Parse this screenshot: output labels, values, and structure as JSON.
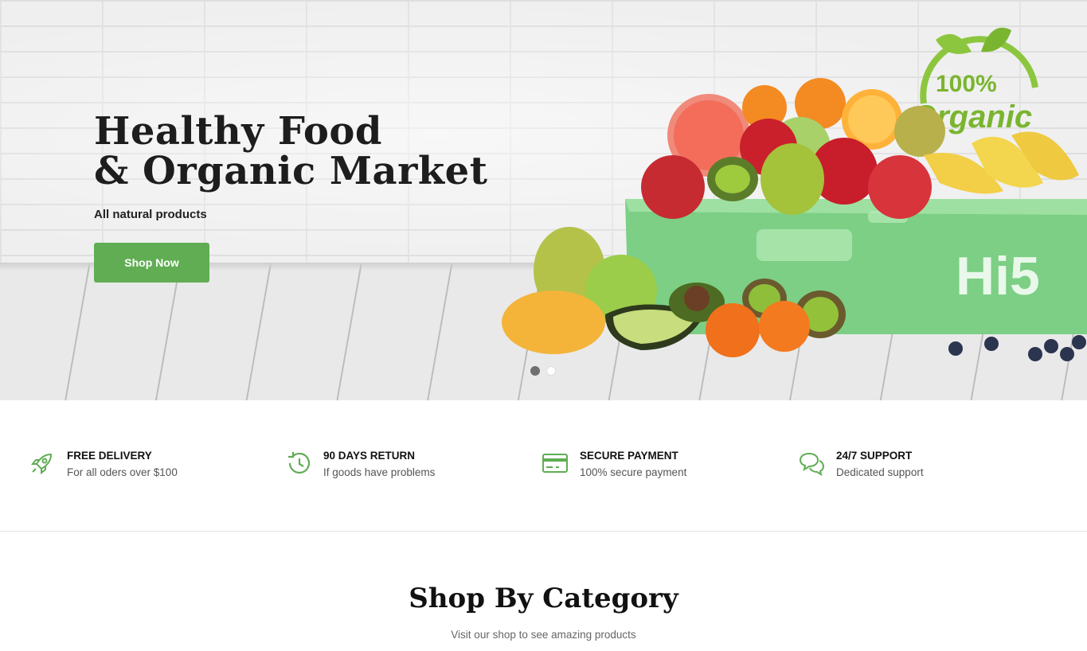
{
  "hero": {
    "title_line1": "Healthy Food",
    "title_line2": "& Organic Market",
    "subtitle": "All natural products",
    "button_label": "Shop Now",
    "badge_text": "100%",
    "badge_word": "Organic",
    "box_brand": "Hi5",
    "slides": 2,
    "active_slide": 1,
    "accent_color": "#60ad54"
  },
  "features": [
    {
      "icon": "rocket-icon",
      "title": "FREE DELIVERY",
      "desc": "For all oders over $100"
    },
    {
      "icon": "history-icon",
      "title": "90 DAYS RETURN",
      "desc": "If goods have problems"
    },
    {
      "icon": "credit-card-icon",
      "title": "SECURE PAYMENT",
      "desc": "100% secure payment"
    },
    {
      "icon": "chat-bubbles-icon",
      "title": "24/7 SUPPORT",
      "desc": "Dedicated support"
    }
  ],
  "category": {
    "title": "Shop By Category",
    "subtitle": "Visit our shop to see amazing products"
  }
}
